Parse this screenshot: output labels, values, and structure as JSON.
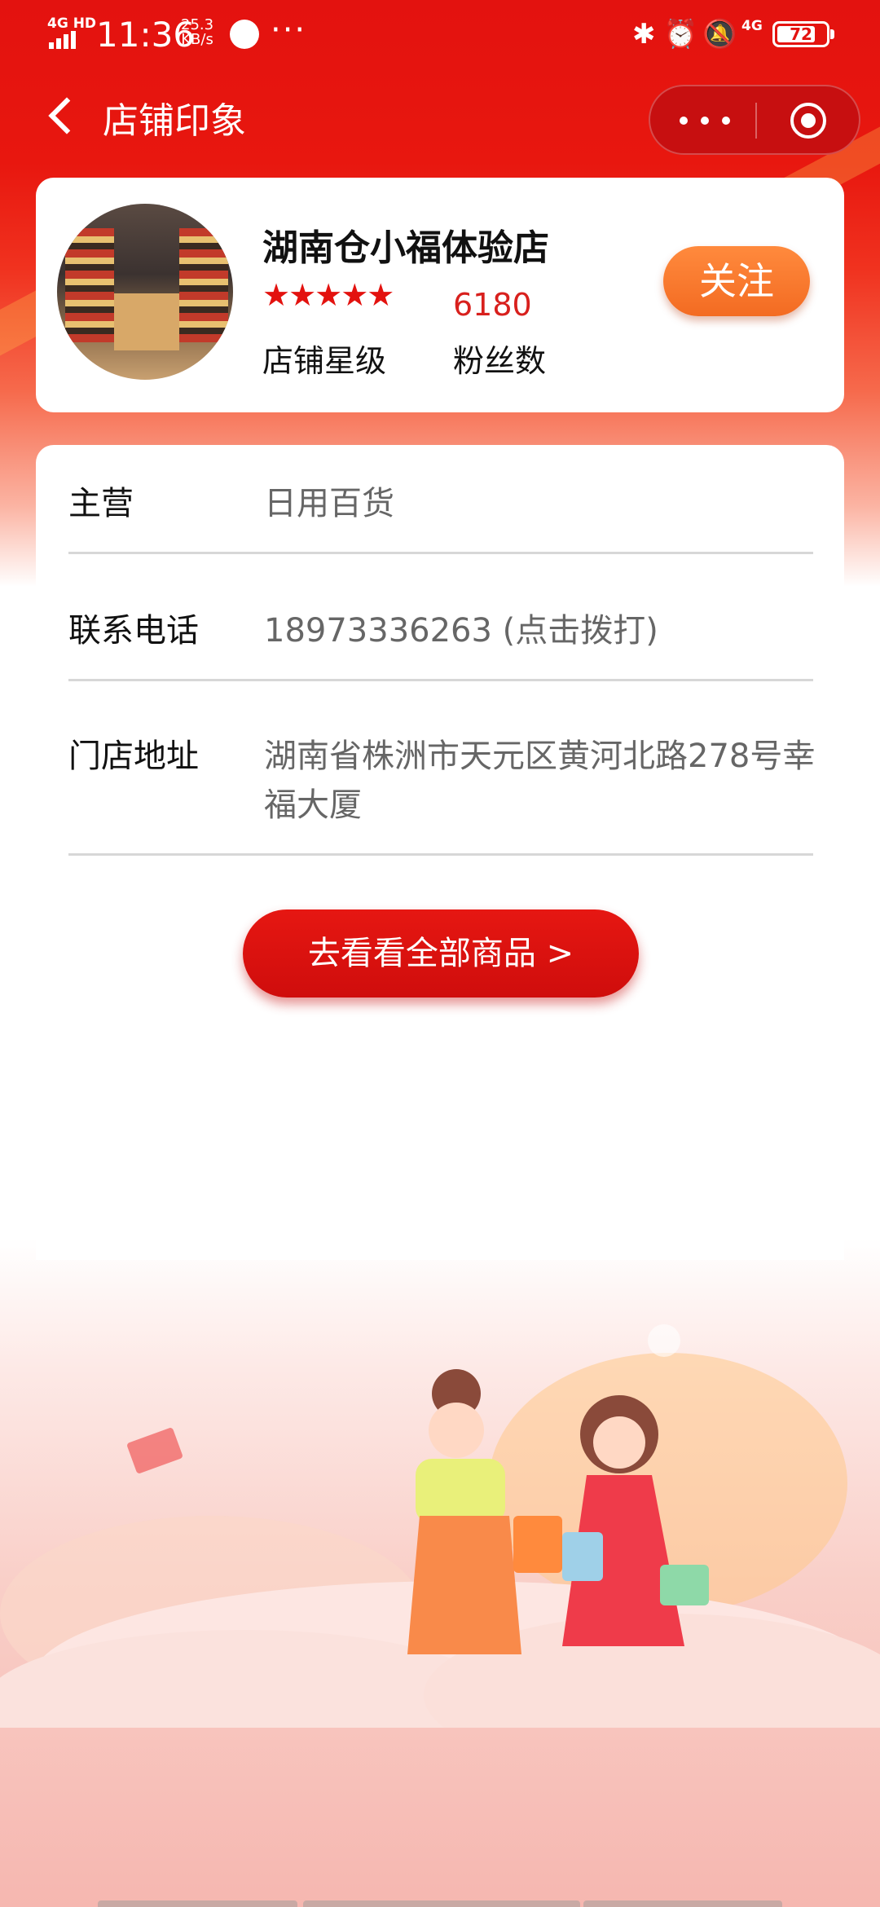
{
  "status_bar": {
    "network": "4G HD",
    "time": "11:36",
    "speed_value": "25.3",
    "speed_unit": "KB/s",
    "more": "···",
    "cell": "4G",
    "battery": "72"
  },
  "nav": {
    "title": "店铺印象"
  },
  "shop": {
    "name": "湖南仓小福体验店",
    "stars": "★★★★★",
    "star_count": 5,
    "fans_count": "6180",
    "level_label": "店铺星级",
    "fans_label": "粉丝数",
    "follow_label": "关注"
  },
  "info": {
    "rows": [
      {
        "key": "主营",
        "value": "日用百货"
      },
      {
        "key": "联系电话",
        "value": "18973336263 (点击拨打)"
      },
      {
        "key": "门店地址",
        "value": "湖南省株洲市天元区黄河北路278号幸福大厦"
      }
    ]
  },
  "cta_label": "去看看全部商品 >",
  "colors": {
    "brand_red": "#e3120f",
    "follow_orange": "#f36b22",
    "text_muted": "#666666"
  }
}
